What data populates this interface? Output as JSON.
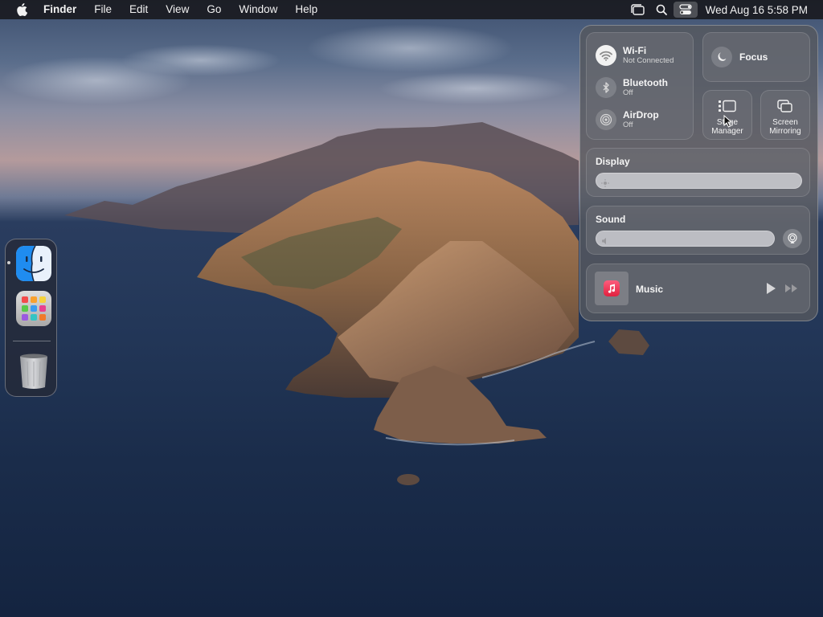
{
  "menubar": {
    "apple_icon": "apple-logo-icon",
    "app_name": "Finder",
    "menus": [
      "File",
      "Edit",
      "View",
      "Go",
      "Window",
      "Help"
    ],
    "status_icons": [
      "stage-manager-icon",
      "search-icon",
      "control-center-icon"
    ],
    "clock": "Wed Aug 16  5:58 PM"
  },
  "dock": {
    "apps": [
      "finder-icon",
      "launchpad-icon",
      "trash-icon"
    ]
  },
  "control_center": {
    "wifi": {
      "label": "Wi-Fi",
      "status": "Not Connected"
    },
    "bluetooth": {
      "label": "Bluetooth",
      "status": "Off"
    },
    "airdrop": {
      "label": "AirDrop",
      "status": "Off"
    },
    "focus": {
      "label": "Focus"
    },
    "stage_manager": {
      "line1": "Stage",
      "line2": "Manager"
    },
    "screen_mirroring": {
      "line1": "Screen",
      "line2": "Mirroring"
    },
    "display": {
      "label": "Display",
      "brightness": 0.0
    },
    "sound": {
      "label": "Sound",
      "volume": 0.0
    },
    "music": {
      "label": "Music"
    }
  },
  "colors": {
    "menubar_bg": "#18181c",
    "panel_bg": "#56585e",
    "music_red": "#fc3c44"
  }
}
